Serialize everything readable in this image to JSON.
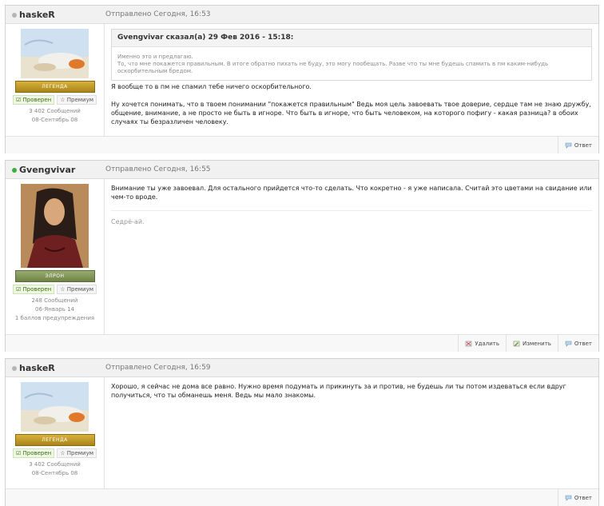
{
  "posts": [
    {
      "author": "haskeR",
      "online": false,
      "date": "Отправлено Сегодня, 16:53",
      "rank": "ЛЕГЕНДА",
      "badge_verified": "Проверен",
      "badge_premium": "Премиум",
      "stats": [
        "3 402 Сообщений",
        "08-Сентябрь 08"
      ],
      "quote": {
        "header": "Gvengvivar сказал(а) 29 Фев 2016 - 15:18:",
        "lines": [
          "Именно это и предлагаю.",
          "То, что мне покажется правильным. В итоге обратно пихать не буду, это могу пообещать. Разве что ты мне будешь спамить в пм каким-нибудь оскорбительным бредом."
        ]
      },
      "paragraphs": [
        "Я вообще то в пм не спамил тебе ничего оскорбительного.",
        "Ну хочется понимать, что в твоем понимании \"покажется правильным\" Ведь моя цель завоевать твое доверие, сердце там не знаю дружбу, общение, внимание, а не просто не быть в игноре. Что быть в игноре, что быть человеком, на которого пофигу - какая разница? в обоих случаях ты безразличен человеку."
      ],
      "footer": [
        "Ответ"
      ]
    },
    {
      "author": "Gvengvivar",
      "online": true,
      "date": "Отправлено Сегодня, 16:55",
      "rank": "ЭЛРОН",
      "badge_verified": "Проверен",
      "badge_premium": "Премиум",
      "stats": [
        "248 Сообщений",
        "06-Январь 14",
        "1 баллов предупреждения"
      ],
      "paragraphs": [
        "Внимание ты уже завоевал. Для остального прийдется что-то сделать. Что кокретно - я уже написала. Считай это цветами на свидание или чем-то вроде."
      ],
      "signature": "Седрё-ай.",
      "footer": [
        "Удалить",
        "Изменить",
        "Ответ"
      ]
    },
    {
      "author": "haskeR",
      "online": false,
      "date": "Отправлено Сегодня, 16:59",
      "rank": "ЛЕГЕНДА",
      "badge_verified": "Проверен",
      "badge_premium": "Премиум",
      "stats": [
        "3 402 Сообщений",
        "08-Сентябрь 08"
      ],
      "paragraphs": [
        "Хорошо, я сейчас не дома все равно. Нужно время подумать и прикинуть за и против,  не будешь ли ты потом издеваться  если вдруг  получиться, что ты обманешь меня. Ведь мы мало знакомы."
      ],
      "footer": [
        "Ответ"
      ]
    }
  ],
  "colors": {
    "online": "#3cae3c",
    "offline": "#b5b5b5",
    "rank_gold": "#c39a26",
    "rank_green": "#7d9152"
  }
}
